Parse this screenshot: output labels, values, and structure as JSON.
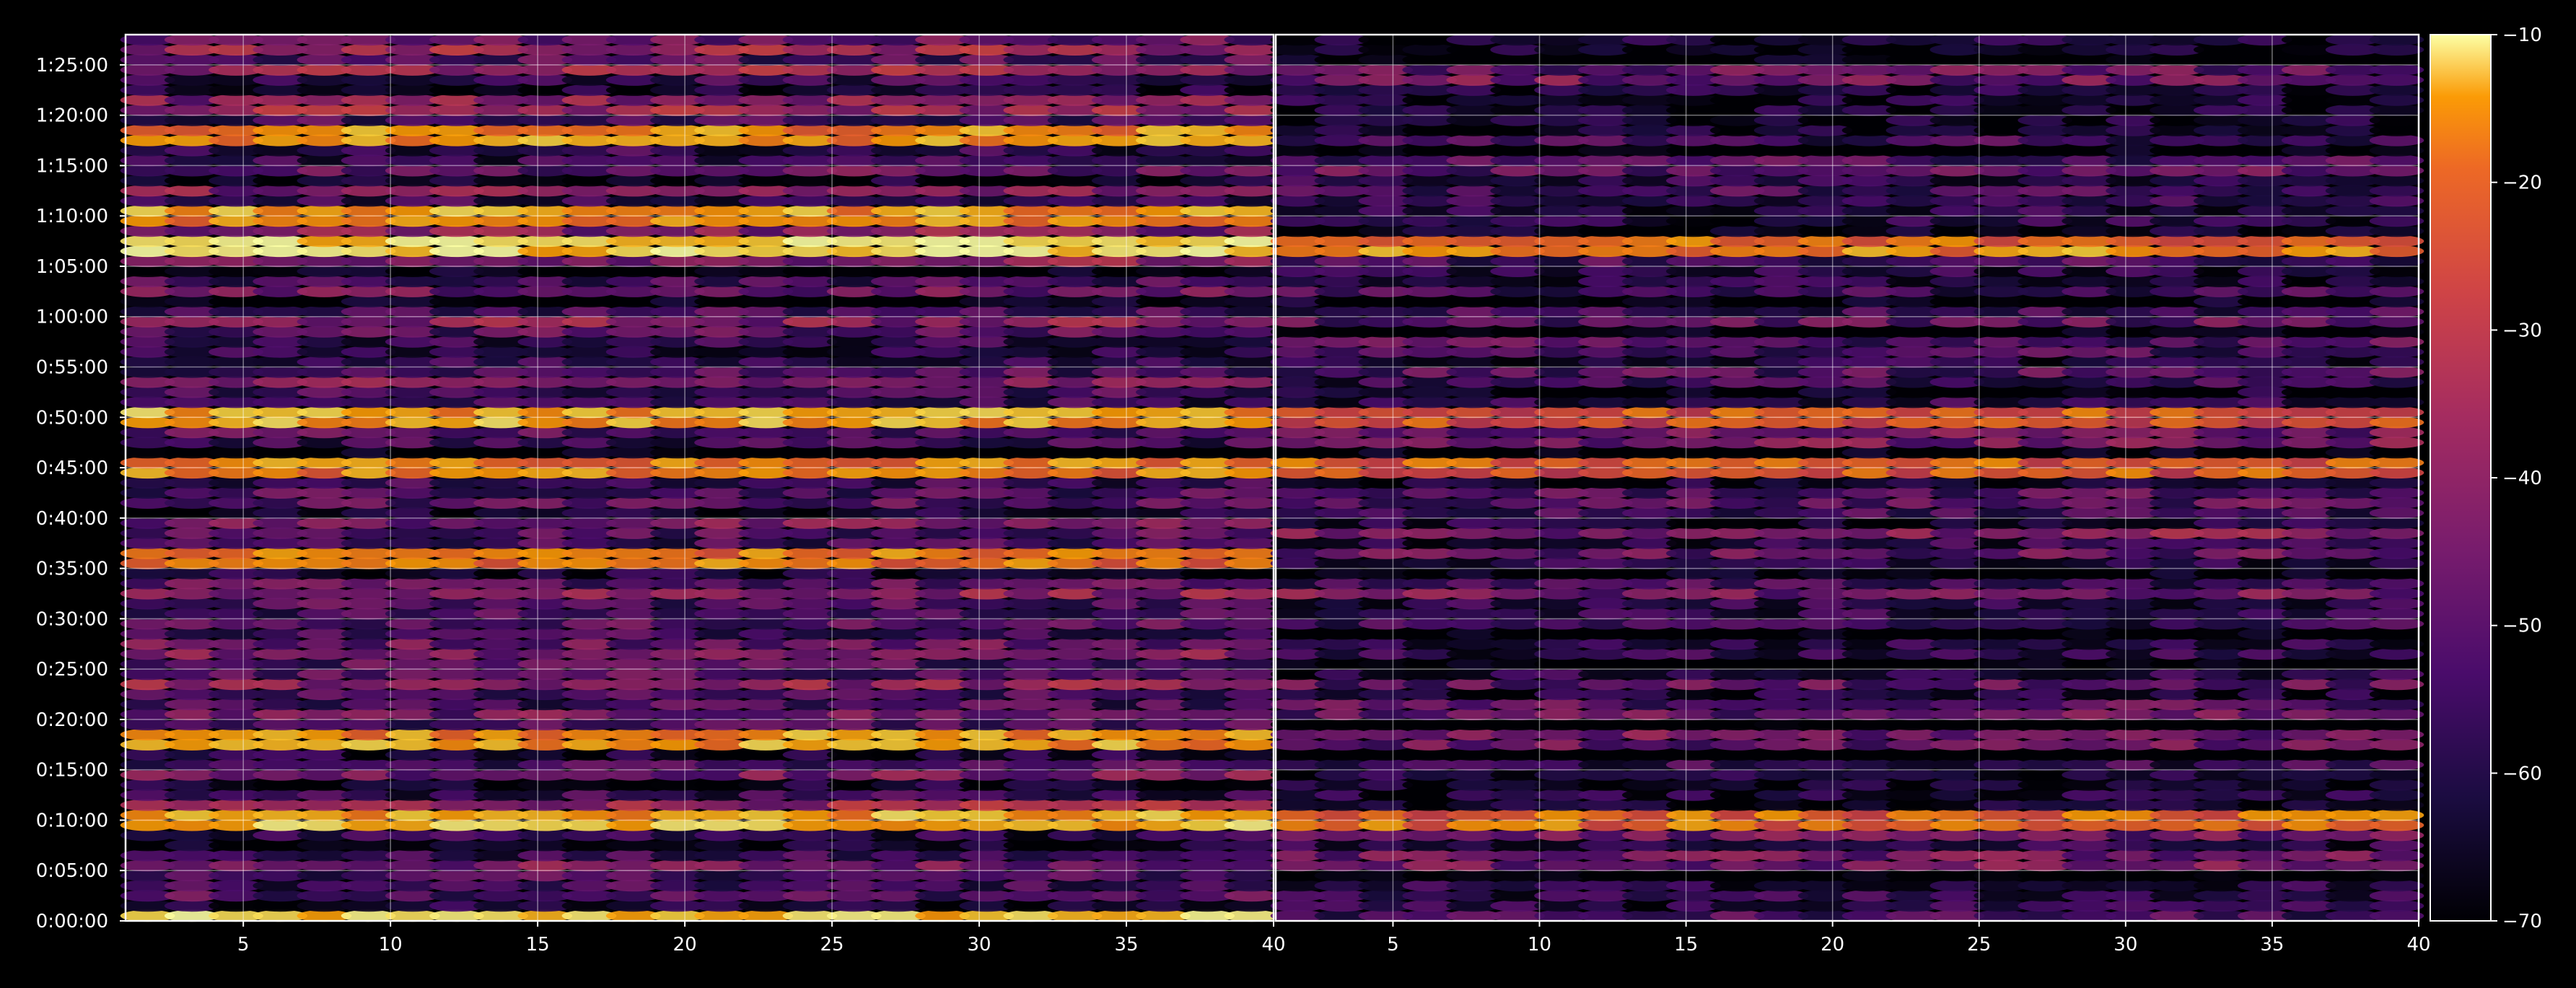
{
  "chart_data": {
    "type": "heatmap",
    "title": "",
    "colormap": "inferno",
    "background": "#000000",
    "grid": true,
    "panels": [
      {
        "id": "left",
        "x_range": [
          1,
          40
        ],
        "x_ticks": [
          5,
          10,
          15,
          20,
          25,
          30,
          35,
          40
        ],
        "y_range_seconds": [
          0,
          5280
        ],
        "y_tick_labels": [
          "0:00:00",
          "0:05:00",
          "0:10:00",
          "0:15:00",
          "0:20:00",
          "0:25:00",
          "0:30:00",
          "0:35:00",
          "0:40:00",
          "0:45:00",
          "0:50:00",
          "0:55:00",
          "1:00:00",
          "1:05:00",
          "1:10:00",
          "1:15:00",
          "1:20:00",
          "1:25:00"
        ],
        "y_tick_values_seconds": [
          0,
          300,
          600,
          900,
          1200,
          1500,
          1800,
          2100,
          2400,
          2700,
          3000,
          3300,
          3600,
          3900,
          4200,
          4500,
          4800,
          5100
        ],
        "hot_rows": [
          {
            "time": "1:07:00",
            "level": -13
          },
          {
            "time": "1:10:00",
            "level": -22
          },
          {
            "time": "1:18:00",
            "level": -24
          },
          {
            "time": "0:50:00",
            "level": -18
          },
          {
            "time": "0:45:00",
            "level": -25
          },
          {
            "time": "0:36:00",
            "level": -27
          },
          {
            "time": "0:18:00",
            "level": -20
          },
          {
            "time": "0:10:00",
            "level": -18
          },
          {
            "time": "0:00:00",
            "level": -15
          }
        ]
      },
      {
        "id": "right",
        "x_range": [
          1,
          40
        ],
        "x_ticks": [
          5,
          10,
          15,
          20,
          25,
          30,
          35,
          40
        ],
        "hot_rows": [
          {
            "time": "1:07:00",
            "level": -22
          },
          {
            "time": "0:50:00",
            "level": -26
          },
          {
            "time": "0:45:00",
            "level": -28
          },
          {
            "time": "0:10:00",
            "level": -24
          }
        ]
      }
    ],
    "colorbar": {
      "range": [
        -70,
        -10
      ],
      "ticks": [
        -10,
        -20,
        -30,
        -40,
        -50,
        -60,
        -70
      ],
      "tick_labels": [
        "−10",
        "−20",
        "−30",
        "−40",
        "−50",
        "−60",
        "−70"
      ]
    }
  }
}
